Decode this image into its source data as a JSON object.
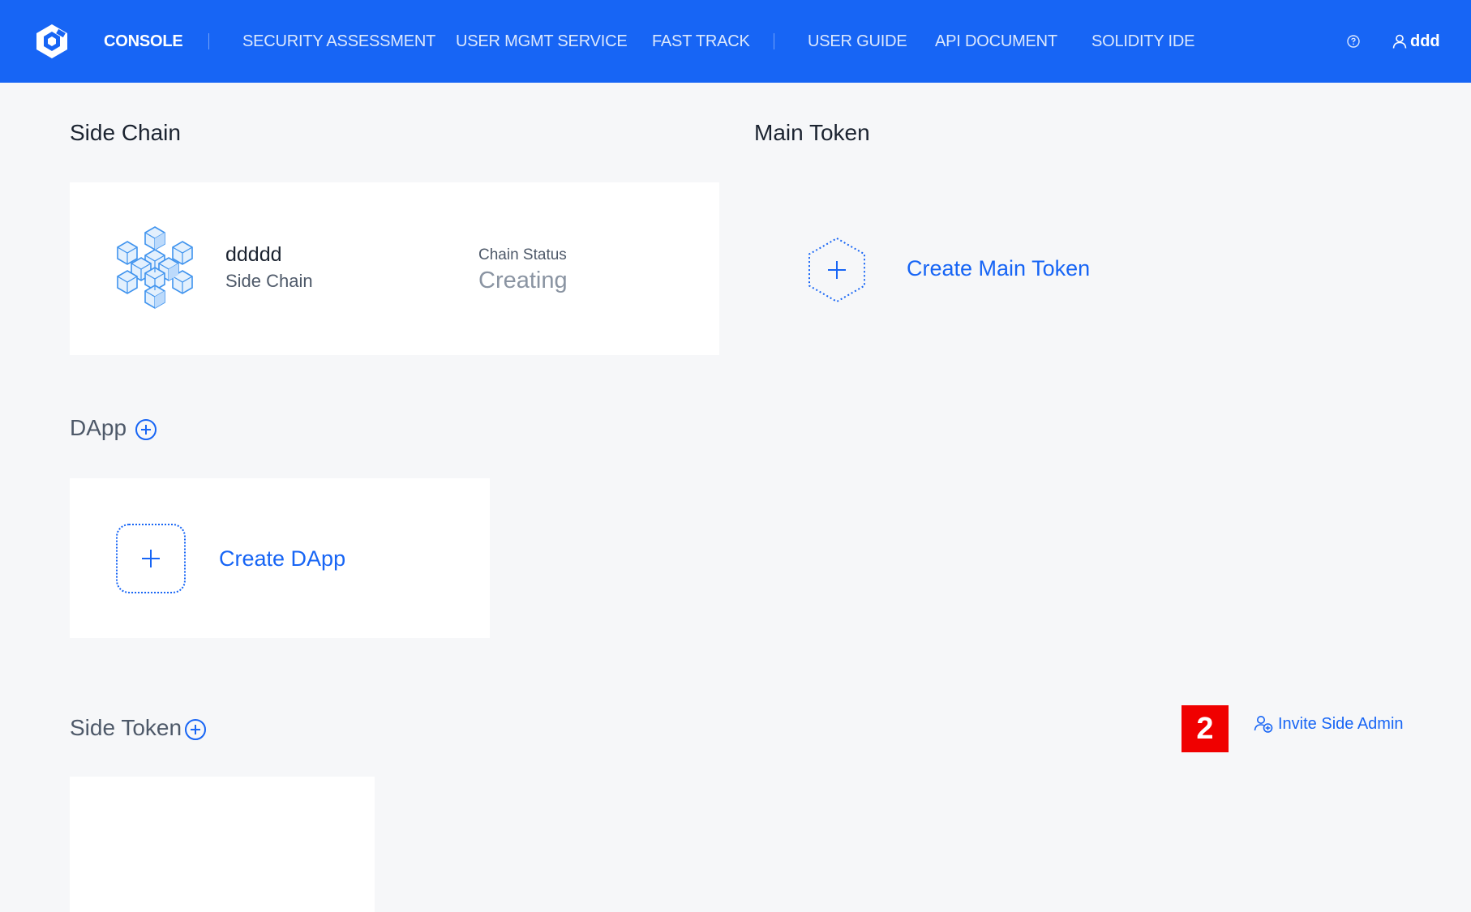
{
  "colors": {
    "brand": "#1765f5",
    "background": "#f6f7f9",
    "card": "#ffffff",
    "marker": "#f00000"
  },
  "header": {
    "logo_icon": "shield-hexagon-logo",
    "nav": [
      {
        "label": "CONSOLE"
      },
      {
        "label": "SECURITY ASSESSMENT"
      },
      {
        "label": "USER MGMT SERVICE"
      },
      {
        "label": "FAST TRACK"
      },
      {
        "label": "USER GUIDE"
      },
      {
        "label": "API DOCUMENT"
      },
      {
        "label": "SOLIDITY IDE"
      }
    ],
    "help_icon": "question-circle-icon",
    "user_icon": "user-icon",
    "username": "ddd"
  },
  "side_chain": {
    "title": "Side Chain",
    "icon": "cube-cluster-icon",
    "name": "ddddd",
    "type_label": "Side Chain",
    "status_label": "Chain Status",
    "status_value": "Creating"
  },
  "main_token": {
    "title": "Main Token",
    "add_icon": "hexagon-plus-icon",
    "create_label": "Create Main Token"
  },
  "dapp": {
    "title": "DApp",
    "add_icon": "plus-circle-icon",
    "create_icon": "plus-square-icon",
    "create_label": "Create DApp"
  },
  "side_token": {
    "title": "Side Token",
    "add_icon": "plus-circle-icon"
  },
  "invite": {
    "icon": "user-add-icon",
    "label": "Invite Side Admin"
  },
  "annotation_marker": "2"
}
